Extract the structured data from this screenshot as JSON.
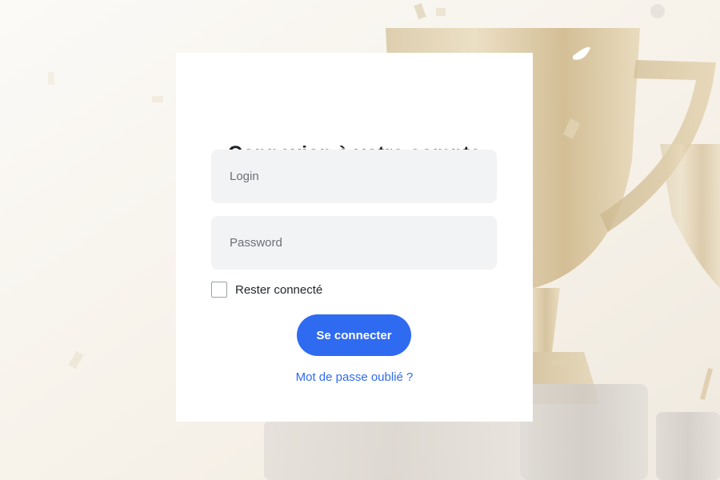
{
  "login_form": {
    "title": "Connexion à votre compte",
    "login_placeholder": "Login",
    "password_placeholder": "Password",
    "remember_label": "Rester connecté",
    "remember_checked": false,
    "submit_label": "Se connecter",
    "forgot_link": "Mot de passe oublié ?"
  },
  "colors": {
    "primary": "#2f6bf1",
    "field_background": "#f2f3f5",
    "card_background": "#ffffff",
    "title_text": "#1f2328"
  },
  "background": {
    "subject": "golden-trophy-cups"
  }
}
